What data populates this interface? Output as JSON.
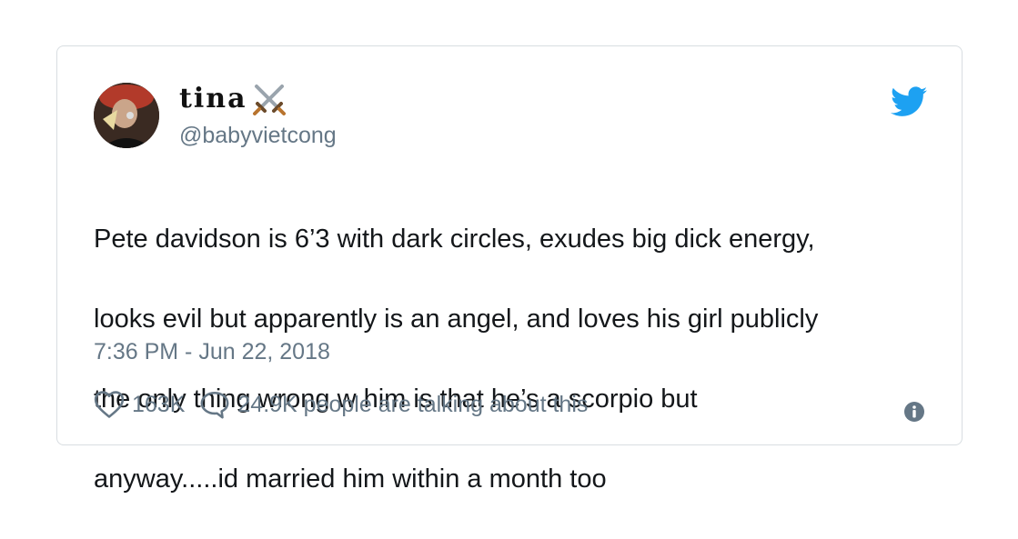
{
  "tweet": {
    "display_name": "tina",
    "name_emoji_icon": "crossed-swords-icon",
    "handle": "@babyvietcong",
    "text_lines": [
      "Pete davidson is 6’3 with dark circles, exudes big dick energy,",
      "looks evil but apparently is an angel, and loves his girl publicly",
      "the only thing wrong w him is that he’s a scorpio but",
      "anyway.....id married him within a month too"
    ],
    "timestamp": "7:36 PM - Jun 22, 2018",
    "likes": "163K",
    "talking": "24.9K people are talking about this"
  },
  "icons": {
    "brand": "twitter-bird-icon",
    "like": "heart-icon",
    "reply": "speech-bubble-icon",
    "info": "info-icon"
  },
  "colors": {
    "twitter_blue": "#1da1f2",
    "secondary_text": "#657786",
    "primary_text": "#14171a",
    "border": "#d8dde1"
  }
}
